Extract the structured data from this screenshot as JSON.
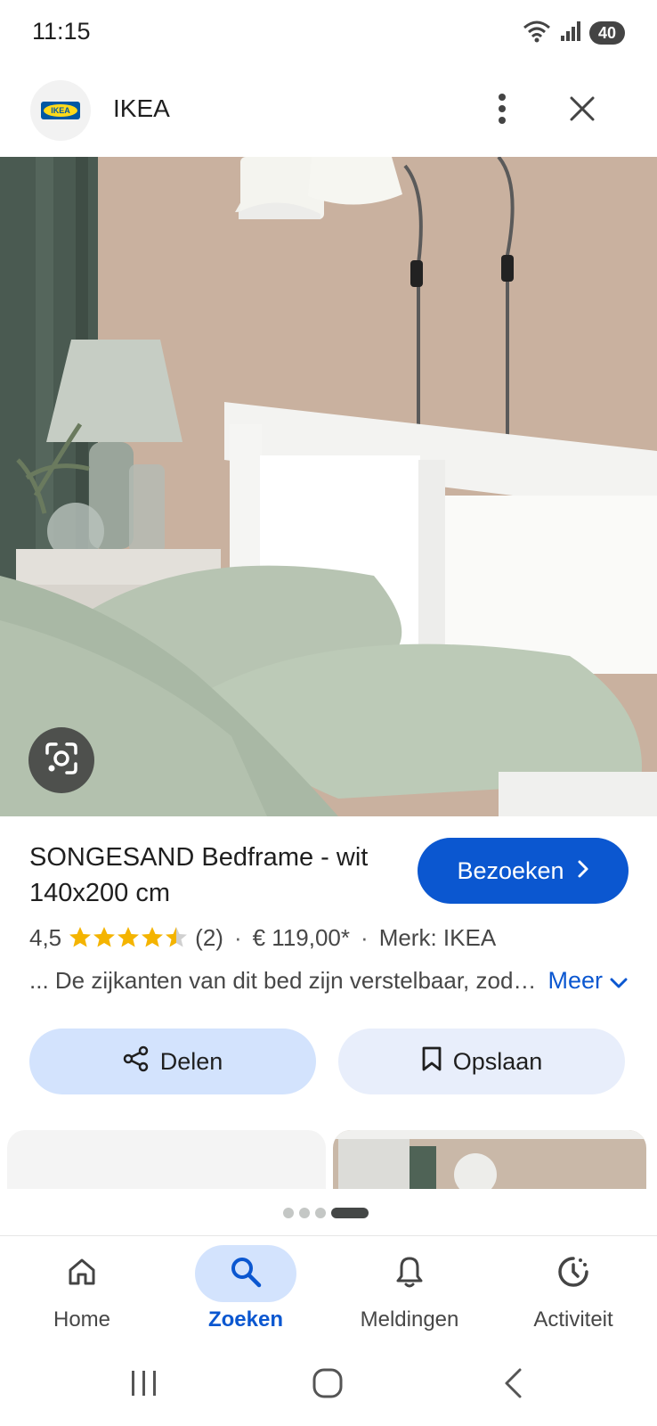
{
  "status_bar": {
    "time": "11:15",
    "battery": "40",
    "icons": [
      "wifi-icon",
      "signal-icon",
      "battery-icon"
    ]
  },
  "app_bar": {
    "site_name": "IKEA",
    "logo_text": "IKEA",
    "more_icon": "more-vert-icon",
    "close_icon": "close-icon"
  },
  "hero": {
    "lens_icon": "google-lens-icon"
  },
  "product": {
    "title": "SONGESAND Bedframe - wit 140x200 cm",
    "visit_label": "Bezoeken",
    "rating": "4,5",
    "rating_value": 4.5,
    "rating_max": 5,
    "review_count": "(2)",
    "price": "€ 119,00*",
    "brand": "Merk: IKEA",
    "description": "... De zijkanten van dit bed zijn verstelbaar, zodat je matrassen van verschillende diktes kunt gebruiken.",
    "more_label": "Meer"
  },
  "actions": {
    "share_label": "Delen",
    "save_label": "Opslaan"
  },
  "carousel": {
    "pages": 4,
    "active_page": 4
  },
  "bottom_nav": {
    "items": [
      {
        "label": "Home",
        "icon": "home-icon"
      },
      {
        "label": "Zoeken",
        "icon": "search-icon"
      },
      {
        "label": "Meldingen",
        "icon": "bell-icon"
      },
      {
        "label": "Activiteit",
        "icon": "activity-icon"
      }
    ],
    "active": "Zoeken"
  },
  "colors": {
    "accent": "#0b57d0",
    "accent_container": "#d3e3fd",
    "star": "#f4b400"
  }
}
